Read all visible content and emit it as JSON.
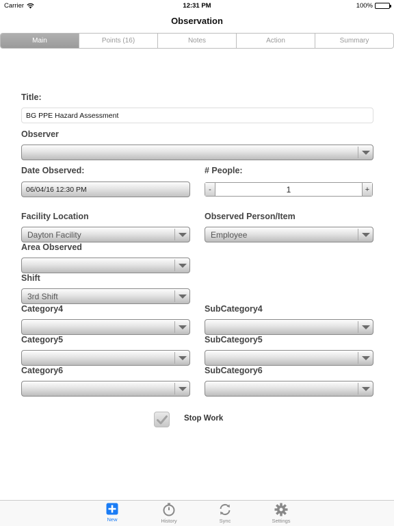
{
  "status": {
    "carrier": "Carrier",
    "time": "12:31 PM",
    "battery": "100%"
  },
  "nav": {
    "title": "Observation"
  },
  "tabs": [
    "Main",
    "Points (16)",
    "Notes",
    "Action",
    "Summary"
  ],
  "form": {
    "title_label": "Title:",
    "title_value": "BG PPE Hazard Assessment",
    "observer_label": "Observer",
    "observer_value": "",
    "date_label": "Date Observed:",
    "date_value": "06/04/16 12:30 PM",
    "people_label": "# People:",
    "people_value": "1",
    "people_minus": "-",
    "people_plus": "+",
    "facility_label": "Facility Location",
    "facility_value": "Dayton Facility",
    "observed_person_label": "Observed Person/Item",
    "observed_person_value": "Employee",
    "area_label": "Area Observed",
    "area_value": "",
    "shift_label": "Shift",
    "shift_value": "3rd Shift",
    "category4_label": "Category4",
    "category4_value": "",
    "subcategory4_label": "SubCategory4",
    "subcategory4_value": "",
    "category5_label": "Category5",
    "category5_value": "",
    "subcategory5_label": "SubCategory5",
    "subcategory5_value": "",
    "category6_label": "Category6",
    "category6_value": "",
    "subcategory6_label": "SubCategory6",
    "subcategory6_value": "",
    "stopwork_label": "Stop Work",
    "stopwork_checked": true
  },
  "tabbar": [
    {
      "label": "New",
      "icon": "plus-square-icon",
      "active": true
    },
    {
      "label": "History",
      "icon": "stopwatch-icon",
      "active": false
    },
    {
      "label": "Sync",
      "icon": "sync-icon",
      "active": false
    },
    {
      "label": "Settings",
      "icon": "gear-icon",
      "active": false
    }
  ],
  "colors": {
    "accent": "#1a7cf5",
    "segment_active": "#a6a6a6"
  }
}
